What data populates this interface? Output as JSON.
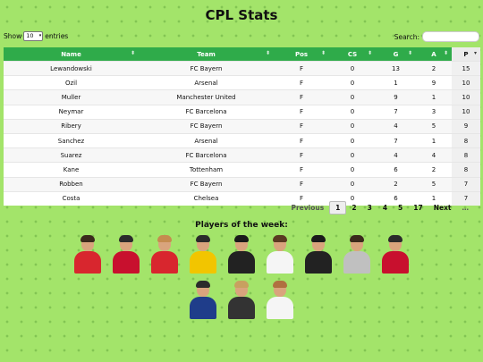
{
  "page": {
    "title": "CPL Stats"
  },
  "controls": {
    "show_label": "Show",
    "entries_value": "10",
    "entries_label": "entries",
    "search_label": "Search:"
  },
  "table": {
    "columns": [
      "Name",
      "Team",
      "Pos",
      "CS",
      "G",
      "A",
      "P"
    ],
    "sorted_column": "P",
    "rows": [
      [
        "Lewandowski",
        "FC Bayern",
        "F",
        "0",
        "13",
        "2",
        "15"
      ],
      [
        "Ozil",
        "Arsenal",
        "F",
        "0",
        "1",
        "9",
        "10"
      ],
      [
        "Muller",
        "Manchester United",
        "F",
        "0",
        "9",
        "1",
        "10"
      ],
      [
        "Neymar",
        "FC Barcelona",
        "F",
        "0",
        "7",
        "3",
        "10"
      ],
      [
        "Ribery",
        "FC Bayern",
        "F",
        "0",
        "4",
        "5",
        "9"
      ],
      [
        "Sanchez",
        "Arsenal",
        "F",
        "0",
        "7",
        "1",
        "8"
      ],
      [
        "Suarez",
        "FC Barcelona",
        "F",
        "0",
        "4",
        "4",
        "8"
      ],
      [
        "Kane",
        "Tottenham",
        "F",
        "0",
        "6",
        "2",
        "8"
      ],
      [
        "Robben",
        "FC Bayern",
        "F",
        "0",
        "2",
        "5",
        "7"
      ],
      [
        "Costa",
        "Chelsea",
        "F",
        "0",
        "6",
        "1",
        "7"
      ]
    ]
  },
  "pagination": {
    "previous": "Previous",
    "pages": [
      "1",
      "2",
      "3",
      "4",
      "5",
      "17"
    ],
    "current": "1",
    "next": "Next",
    "last": "…"
  },
  "players_of_week": {
    "title": "Players of the week:",
    "photos": [
      {
        "icon": "player-photo",
        "shirt": "#d8262e",
        "hair": "#3b2a1c"
      },
      {
        "icon": "player-photo",
        "shirt": "#c8102e",
        "hair": "#2b2b2b"
      },
      {
        "icon": "player-photo",
        "shirt": "#d8262e",
        "hair": "#c58c4f"
      },
      {
        "icon": "player-photo",
        "shirt": "#f2c500",
        "hair": "#2b2b2b"
      },
      {
        "icon": "player-photo",
        "shirt": "#222222",
        "hair": "#1a1a1a"
      },
      {
        "icon": "player-photo",
        "shirt": "#f5f5f5",
        "hair": "#5a3a22"
      },
      {
        "icon": "player-photo",
        "shirt": "#222222",
        "hair": "#1a1a1a"
      },
      {
        "icon": "player-photo",
        "shirt": "#c0c0c0",
        "hair": "#3b2a1c"
      },
      {
        "icon": "player-photo",
        "shirt": "#c8102e",
        "hair": "#2b2b2b"
      },
      {
        "icon": "player-photo",
        "shirt": "#1f3d8a",
        "hair": "#2b2b2b"
      },
      {
        "icon": "player-photo",
        "shirt": "#333333",
        "hair": "#c8a060"
      },
      {
        "icon": "player-photo",
        "shirt": "#f5f5f5",
        "hair": "#b07040"
      }
    ]
  }
}
